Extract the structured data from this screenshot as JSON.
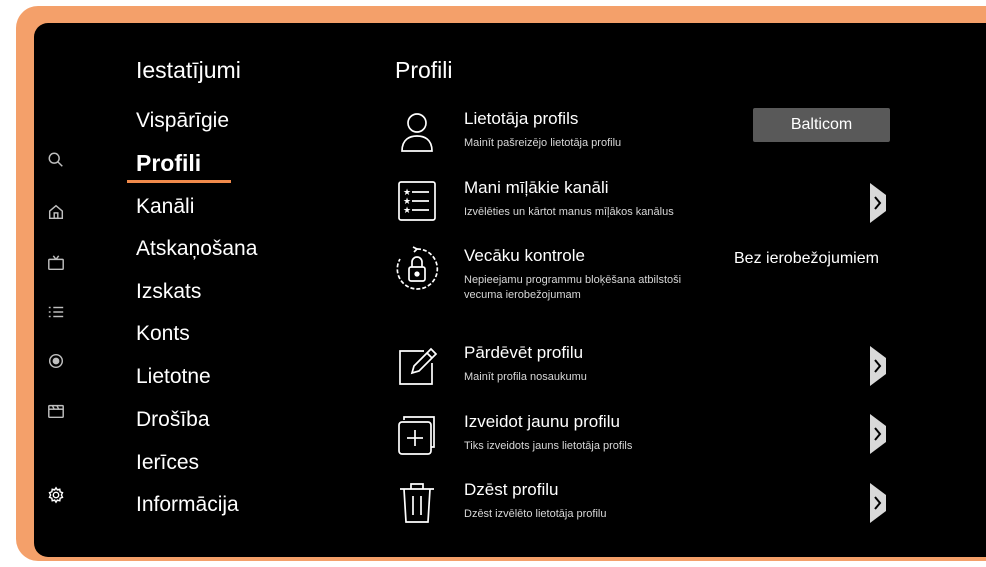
{
  "colors": {
    "frame": "#f4a06a",
    "background": "#000000",
    "accent": "#f08a4b",
    "button": "#595959"
  },
  "rail": [
    {
      "name": "search-icon"
    },
    {
      "name": "home-icon"
    },
    {
      "name": "tv-icon"
    },
    {
      "name": "list-icon"
    },
    {
      "name": "record-icon"
    },
    {
      "name": "clapperboard-icon"
    },
    {
      "name": "gear-icon"
    }
  ],
  "menu": {
    "title": "Iestatījumi",
    "items": [
      {
        "label": "Vispārīgie"
      },
      {
        "label": "Profili"
      },
      {
        "label": "Kanāli"
      },
      {
        "label": "Atskaņošana"
      },
      {
        "label": "Izskats"
      },
      {
        "label": "Konts"
      },
      {
        "label": "Lietotne"
      },
      {
        "label": "Drošība"
      },
      {
        "label": "Ierīces"
      },
      {
        "label": "Informācija"
      }
    ]
  },
  "content": {
    "title": "Profili",
    "rows": [
      {
        "title": "Lietotāja profils",
        "subtitle": "Mainīt pašreizējo lietotāja profilu",
        "icon": "user-icon"
      },
      {
        "title": "Mani mīļākie kanāli",
        "subtitle": "Izvēlēties un kārtot manus mīļākos kanālus",
        "icon": "favorites-list-icon"
      },
      {
        "title": "Vecāku kontrole",
        "subtitle": "Nepieejamu programmu bloķēšana atbilstoši vecuma ierobežojumam",
        "icon": "padlock-icon"
      },
      {
        "title": "Pārdēvēt profilu",
        "subtitle": "Mainīt profila nosaukumu",
        "icon": "edit-icon"
      },
      {
        "title": "Izveidot jaunu profilu",
        "subtitle": "Tiks izveidots jauns lietotāja profils",
        "icon": "add-profile-icon"
      },
      {
        "title": "Dzēst profilu",
        "subtitle": "Dzēst izvēlēto lietotāja profilu",
        "icon": "trash-icon"
      }
    ],
    "current_profile": "Balticom",
    "parental_value": "Bez ierobežojumiem",
    "chevron_icon": "chevron-right-icon"
  }
}
